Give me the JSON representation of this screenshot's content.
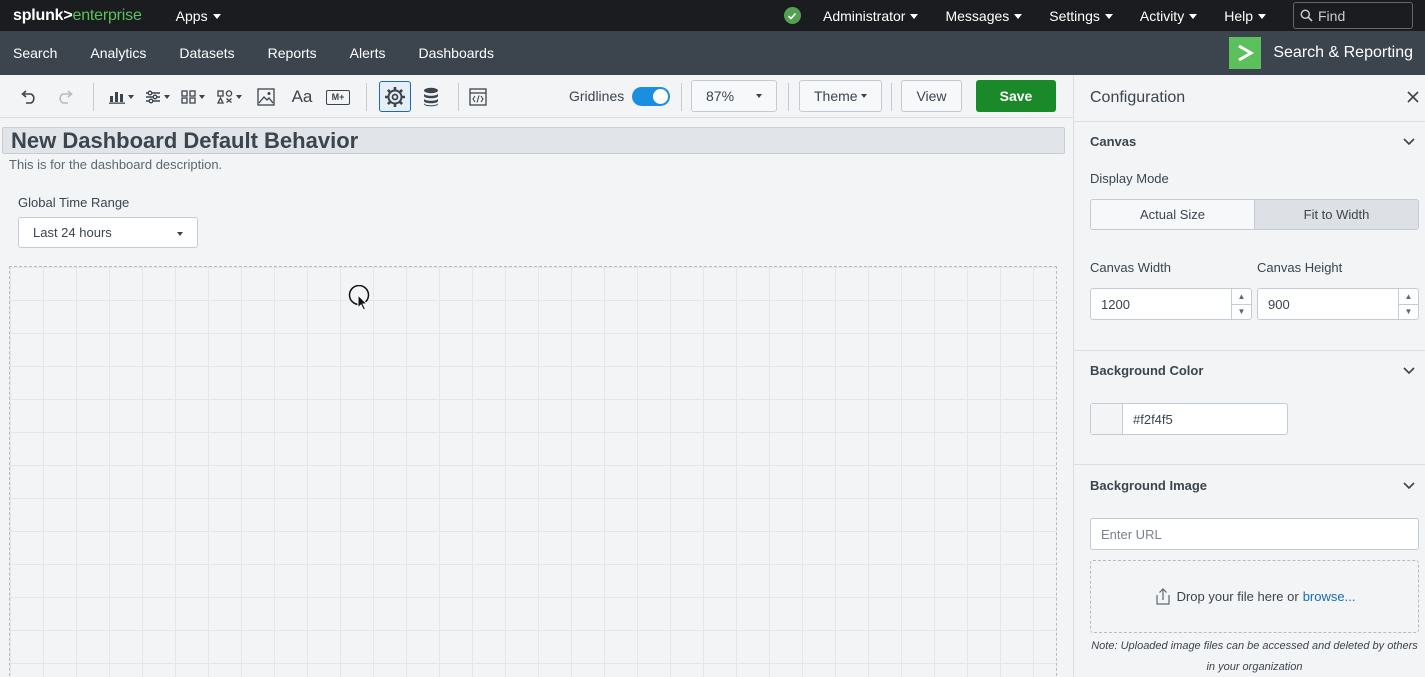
{
  "topbar": {
    "logo_prefix": "splunk>",
    "logo_suffix": "enterprise",
    "apps_label": "Apps",
    "menus": [
      "Administrator",
      "Messages",
      "Settings",
      "Activity",
      "Help"
    ],
    "find_placeholder": "Find"
  },
  "appbar": {
    "nav": [
      "Search",
      "Analytics",
      "Datasets",
      "Reports",
      "Alerts",
      "Dashboards"
    ],
    "app_title": "Search & Reporting"
  },
  "toolbar": {
    "gridlines_label": "Gridlines",
    "gridlines_on": true,
    "zoom": "87%",
    "theme_label": "Theme",
    "view_label": "View",
    "save_label": "Save",
    "text_tool_label": "Aa",
    "markdown_tool_label": "M+"
  },
  "dashboard": {
    "title": "New Dashboard Default Behavior",
    "description": "This is for the dashboard description.",
    "time_range_label": "Global Time Range",
    "time_range_value": "Last 24 hours"
  },
  "config": {
    "title": "Configuration",
    "canvas_section": "Canvas",
    "display_mode_label": "Display Mode",
    "display_modes": [
      "Actual Size",
      "Fit to Width"
    ],
    "display_mode_selected": "Fit to Width",
    "canvas_width_label": "Canvas Width",
    "canvas_width": "1200",
    "canvas_height_label": "Canvas Height",
    "canvas_height": "900",
    "bg_color_section": "Background Color",
    "bg_color_value": "#f2f4f5",
    "bg_image_section": "Background Image",
    "url_placeholder": "Enter URL",
    "drop_text": "Drop your file here or",
    "browse_link": "browse...",
    "note": "Note: Uploaded image files can be accessed and deleted by others in your organization"
  },
  "colors": {
    "topbar_bg": "#1a1c20",
    "appbar_bg": "#3c444d",
    "brand_green": "#5cc05c",
    "save_green": "#1a8929",
    "toggle_blue": "#1a8fe0",
    "link_blue": "#1a6ab8"
  }
}
